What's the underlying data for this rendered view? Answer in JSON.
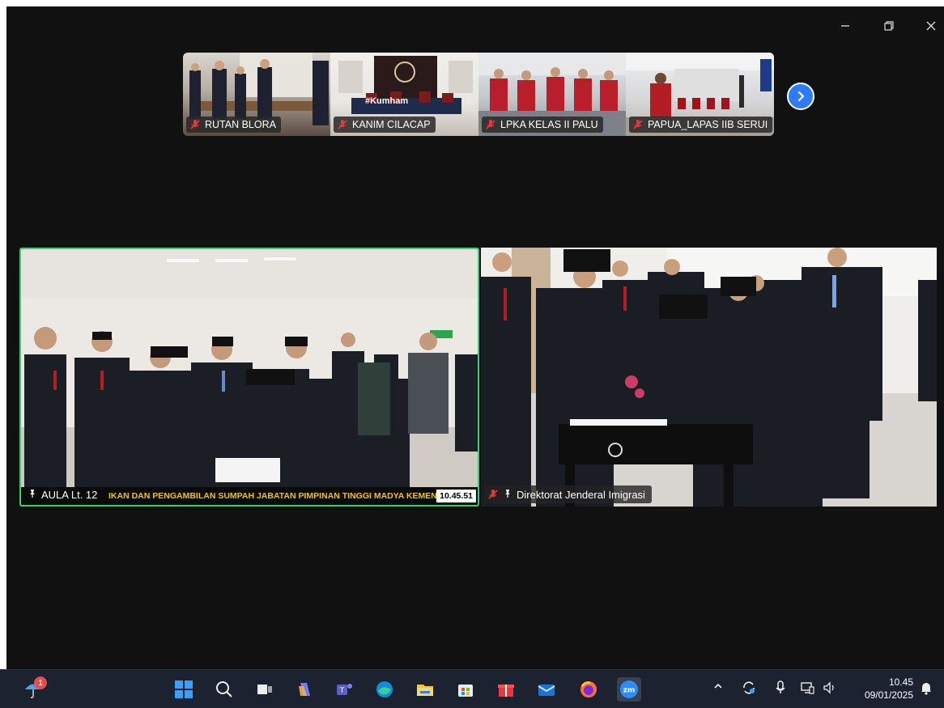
{
  "window": {
    "controls": {
      "minimize_icon": "minimize-icon",
      "restore_icon": "restore-icon",
      "close_icon": "close-icon"
    }
  },
  "gallery": {
    "thumbnails": [
      {
        "label": "RUTAN BLORA",
        "muted": true
      },
      {
        "label": "KANIM CILACAP",
        "muted": true
      },
      {
        "label": "LPKA KELAS II PALU",
        "muted": true
      },
      {
        "label": "PAPUA_LAPAS IIB SERUI",
        "muted": true
      }
    ],
    "next_icon": "chevron-right-icon",
    "banner_text": "#Kumham"
  },
  "main_tiles": [
    {
      "label": "AULA Lt. 12",
      "pinned": true,
      "ticker_text": "IKAN DAN PENGAMBILAN SUMPAH JABATAN PIMPINAN TINGGI MADYA KEMEN",
      "ticker_time": "10.45.51"
    },
    {
      "label": "Direktorat Jenderal Imigrasi",
      "pinned": true,
      "muted": true
    }
  ],
  "taskbar": {
    "notification_count": "1",
    "apps": [
      "start",
      "search",
      "task-view",
      "copilot",
      "teams",
      "edge",
      "file-explorer",
      "store",
      "gift",
      "mail",
      "firefox",
      "zoom"
    ],
    "zoom_label": "zm",
    "clock": {
      "time": "10.45",
      "date": "09/01/2025"
    }
  },
  "colors": {
    "window_bg": "#111111",
    "active_speaker": "#33d17a",
    "taskbar_bg": "#1c2230",
    "accent_blue": "#2d7cff",
    "mute_red": "#e53935"
  }
}
